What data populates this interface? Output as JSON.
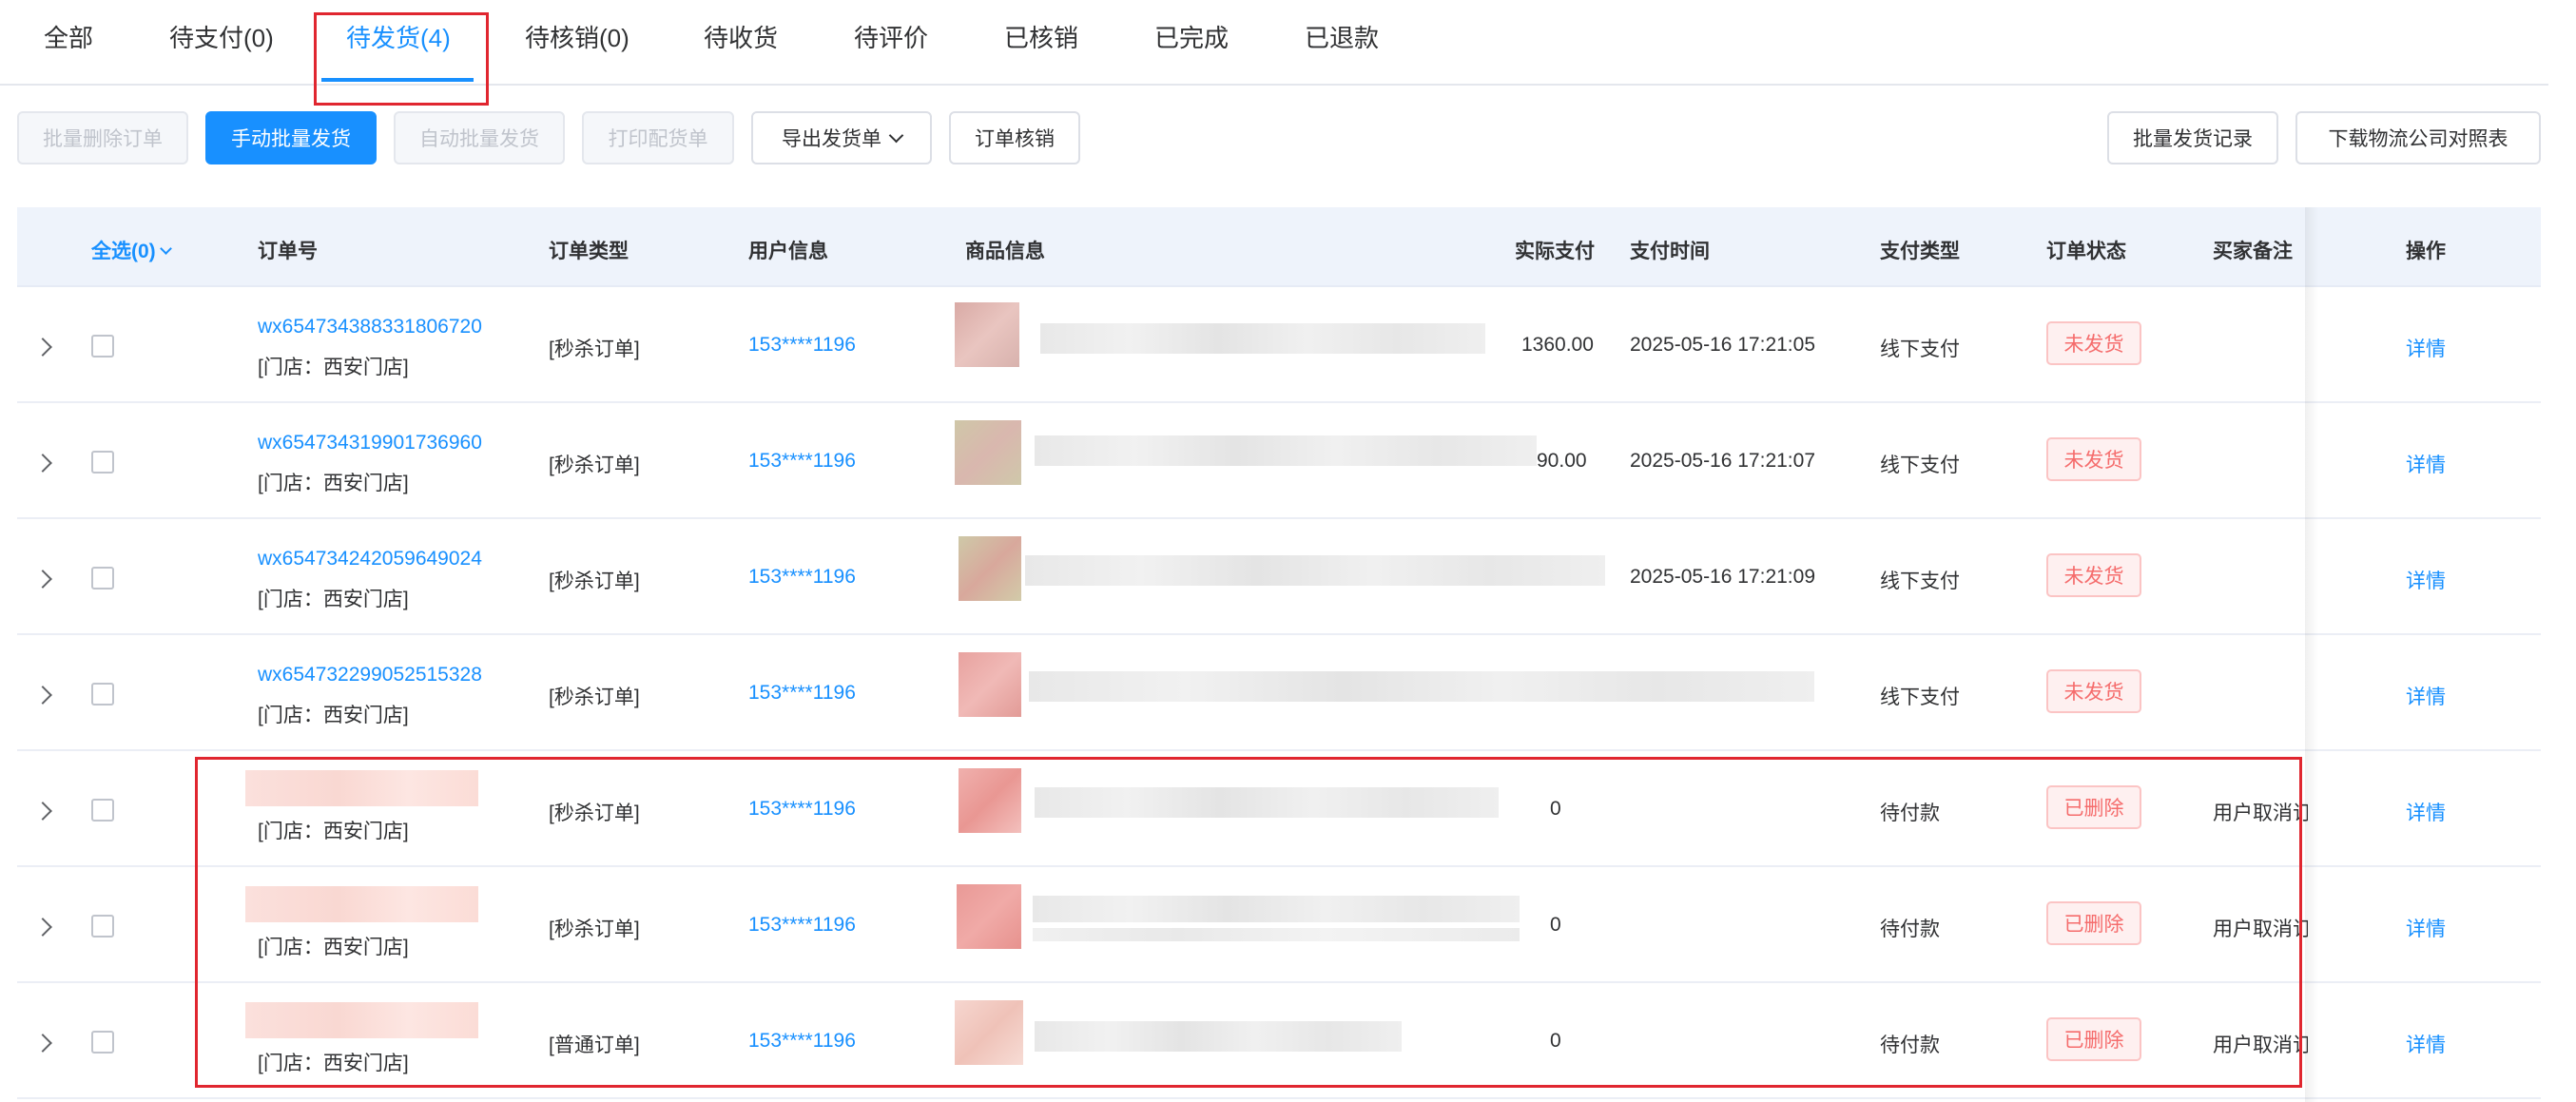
{
  "tabs": [
    {
      "label": "全部"
    },
    {
      "label": "待支付(0)"
    },
    {
      "label": "待发货(4)"
    },
    {
      "label": "待核销(0)"
    },
    {
      "label": "待收货"
    },
    {
      "label": "待评价"
    },
    {
      "label": "已核销"
    },
    {
      "label": "已完成"
    },
    {
      "label": "已退款"
    }
  ],
  "active_tab": "待发货(4)",
  "toolbar": {
    "batch_delete": "批量删除订单",
    "manual_batch_ship": "手动批量发货",
    "auto_batch_ship": "自动批量发货",
    "print_picking": "打印配货单",
    "export_shipping": "导出发货单",
    "order_verify": "订单核销",
    "batch_ship_records": "批量发货记录",
    "download_logistics": "下载物流公司对照表"
  },
  "table": {
    "headers": {
      "select_all": "全选(0)",
      "order_no": "订单号",
      "order_type": "订单类型",
      "user_info": "用户信息",
      "goods_info": "商品信息",
      "actual_paid": "实际支付",
      "pay_time": "支付时间",
      "pay_type": "支付类型",
      "order_status": "订单状态",
      "buyer_note": "买家备注",
      "action": "操作"
    },
    "rows": [
      {
        "order_no": "wx654734388331806720",
        "store": "[门店：西安门店]",
        "type": "[秒杀订单]",
        "user": "153****1196",
        "amount": "1360.00",
        "pay_time": "2025-05-16 17:21:05",
        "pay_type": "线下支付",
        "status": "未发货",
        "note": "",
        "action": "详情"
      },
      {
        "order_no": "wx654734319901736960",
        "store": "[门店：西安门店]",
        "type": "[秒杀订单]",
        "user": "153****1196",
        "amount": "90.00",
        "pay_time": "2025-05-16 17:21:07",
        "pay_type": "线下支付",
        "status": "未发货",
        "note": "",
        "action": "详情"
      },
      {
        "order_no": "wx654734242059649024",
        "store": "[门店：西安门店]",
        "type": "[秒杀订单]",
        "user": "153****1196",
        "amount": "",
        "pay_time": "2025-05-16 17:21:09",
        "pay_type": "线下支付",
        "status": "未发货",
        "note": "",
        "action": "详情"
      },
      {
        "order_no": "wx654732299052515328",
        "store": "[门店：西安门店]",
        "type": "[秒杀订单]",
        "user": "153****1196",
        "amount": "",
        "pay_time": "",
        "pay_type": "线下支付",
        "status": "未发货",
        "note": "",
        "action": "详情"
      },
      {
        "order_no": "",
        "store": "[门店：西安门店]",
        "type": "[秒杀订单]",
        "user": "153****1196",
        "amount": "0",
        "pay_time": "",
        "pay_type": "待付款",
        "status": "已删除",
        "note": "用户取消订",
        "action": "详情"
      },
      {
        "order_no": "",
        "store": "[门店：西安门店]",
        "type": "[秒杀订单]",
        "user": "153****1196",
        "amount": "0",
        "pay_time": "",
        "pay_type": "待付款",
        "status": "已删除",
        "note": "用户取消订",
        "action": "详情"
      },
      {
        "order_no": "",
        "store": "[门店：西安门店]",
        "type": "[普通订单]",
        "user": "153****1196",
        "amount": "0",
        "pay_time": "",
        "pay_type": "待付款",
        "status": "已删除",
        "note": "用户取消订",
        "action": "详情"
      }
    ]
  },
  "colors": {
    "accent": "#1890ff",
    "danger": "#f56c6c",
    "highlight_box": "#e0262f",
    "header_bg": "#eef3fb"
  }
}
